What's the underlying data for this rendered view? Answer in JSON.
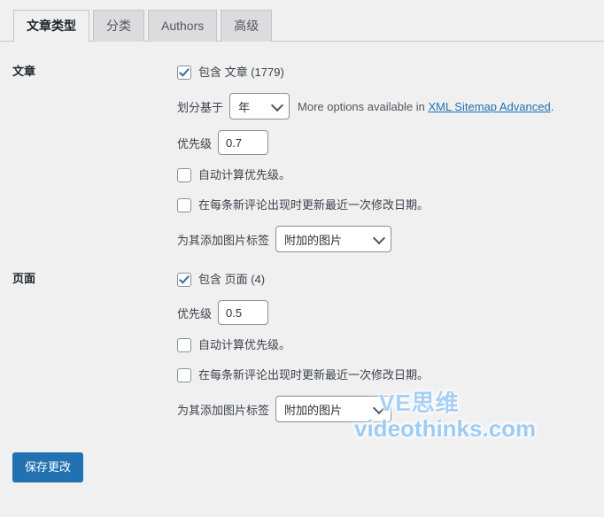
{
  "tabs": [
    {
      "label": "文章类型",
      "active": true
    },
    {
      "label": "分类",
      "active": false
    },
    {
      "label": "Authors",
      "active": false
    },
    {
      "label": "高级",
      "active": false
    }
  ],
  "sections": [
    {
      "heading": "文章",
      "include_label": "包含 文章 (1779)",
      "include_checked": true,
      "split_label": "划分基于",
      "split_value": "年",
      "helper_prefix": "More options available in ",
      "helper_link": "XML Sitemap Advanced",
      "helper_suffix": ".",
      "priority_label": "优先级",
      "priority_value": "0.7",
      "auto_priority_label": "自动计算优先级。",
      "auto_priority_checked": false,
      "comment_update_label": "在每条新评论出现时更新最近一次修改日期。",
      "comment_update_checked": false,
      "image_tag_label": "为其添加图片标签",
      "image_tag_value": "附加的图片"
    },
    {
      "heading": "页面",
      "include_label": "包含 页面 (4)",
      "include_checked": true,
      "priority_label": "优先级",
      "priority_value": "0.5",
      "auto_priority_label": "自动计算优先级。",
      "auto_priority_checked": false,
      "comment_update_label": "在每条新评论出现时更新最近一次修改日期。",
      "comment_update_checked": false,
      "image_tag_label": "为其添加图片标签",
      "image_tag_value": "附加的图片"
    }
  ],
  "submit": {
    "label": "保存更改"
  },
  "watermark": {
    "line1": "VE思维",
    "line2": "videothinks.com"
  },
  "colors": {
    "accent": "#2271b1",
    "background": "#f0f0f1",
    "border": "#c3c4c7",
    "watermark": "#a8d0f5"
  }
}
